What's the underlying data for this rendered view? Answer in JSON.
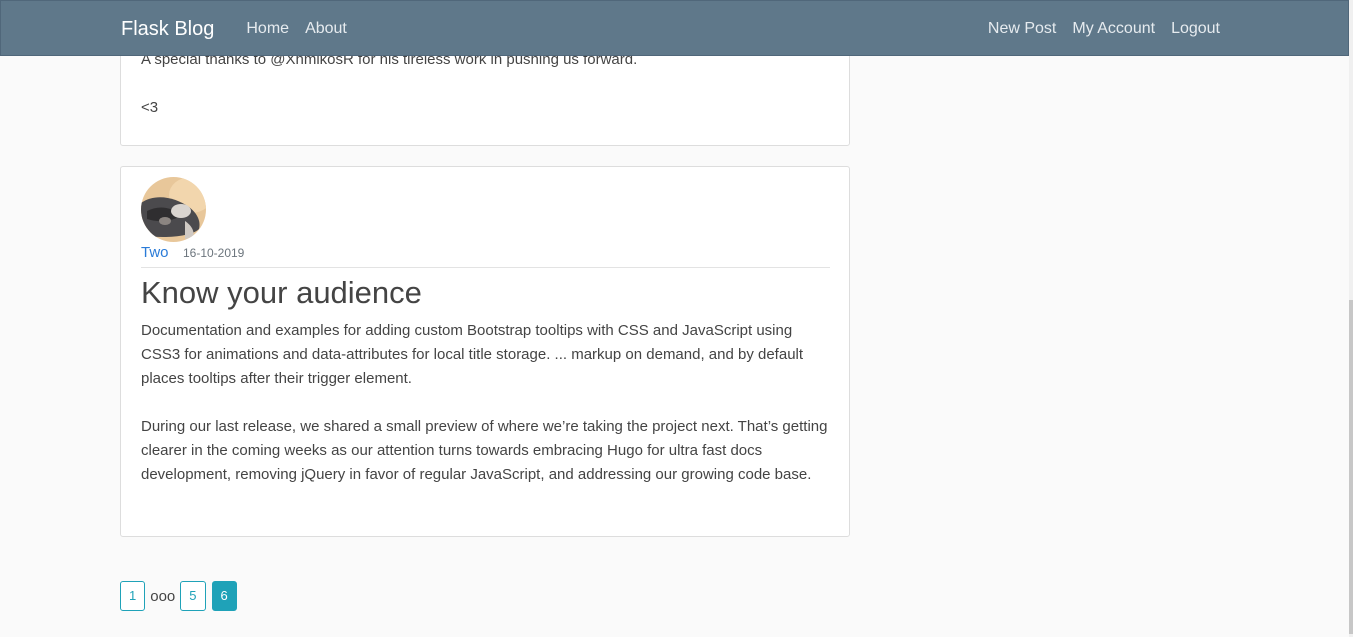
{
  "navbar": {
    "brand": "Flask Blog",
    "links_left": [
      "Home",
      "About"
    ],
    "links_right": [
      "New Post",
      "My Account",
      "Logout"
    ]
  },
  "posts": [
    {
      "content_lines": [
        "A special thanks to @XhmikosR for his tireless work in pushing us forward.",
        "<3"
      ]
    },
    {
      "author": "Two",
      "date": "16-10-2019",
      "title": "Know your audience",
      "paragraphs": [
        "Documentation and examples for adding custom Bootstrap tooltips with CSS and JavaScript using CSS3 for animations and data-attributes for local title storage. ... markup on demand, and by default places tooltips after their trigger element.",
        "During our last release, we shared a small preview of where we’re taking the project next. That’s getting clearer in the coming weeks as our attention turns towards embracing Hugo for ultra fast docs development, removing jQuery in favor of regular JavaScript, and addressing our growing code base."
      ]
    }
  ],
  "pagination": {
    "first": "1",
    "ellipsis": "ooo",
    "prev": "5",
    "current": "6"
  },
  "colors": {
    "navbar": "#5f788a",
    "accent": "#1fa2b8",
    "author_link": "#2a7bd8"
  }
}
